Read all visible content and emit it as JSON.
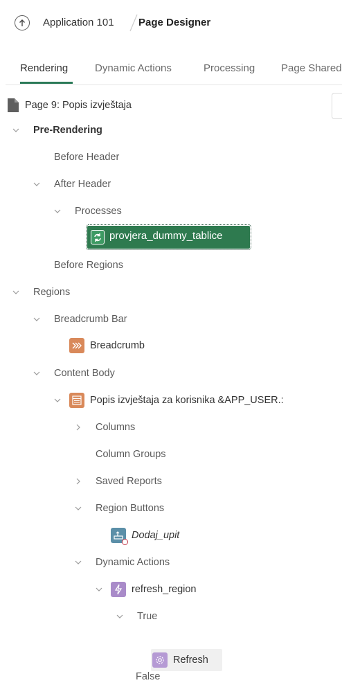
{
  "header": {
    "app_name": "Application 101",
    "page_designer": "Page Designer"
  },
  "tabs": [
    {
      "label": "Rendering",
      "active": true
    },
    {
      "label": "Dynamic Actions",
      "active": false
    },
    {
      "label": "Processing",
      "active": false
    },
    {
      "label": "Page Shared",
      "active": false
    }
  ],
  "tree": {
    "page": "Page 9: Popis izvještaja",
    "pre_rendering": "Pre-Rendering",
    "before_header": "Before Header",
    "after_header": "After Header",
    "processes": "Processes",
    "process_item": "provjera_dummy_tablice",
    "before_regions": "Before Regions",
    "regions": "Regions",
    "breadcrumb_bar": "Breadcrumb Bar",
    "breadcrumb": "Breadcrumb",
    "content_body": "Content Body",
    "report_region": "Popis izvještaja za korisnika &APP_USER.:",
    "columns": "Columns",
    "column_groups": "Column Groups",
    "saved_reports": "Saved Reports",
    "region_buttons": "Region Buttons",
    "button": "Dodaj_upit",
    "dynamic_actions": "Dynamic Actions",
    "da_item": "refresh_region",
    "true_label": "True",
    "refresh_action": "Refresh",
    "false_label": "False"
  },
  "colors": {
    "accent": "#2b7a58",
    "selected_bg": "#2e7a4f",
    "breadcrumb_icon": "#d9895a",
    "report_icon": "#d9895a",
    "button_icon": "#5b8fa8",
    "da_icon": "#a98bc9",
    "action_icon": "#b59ad4"
  }
}
